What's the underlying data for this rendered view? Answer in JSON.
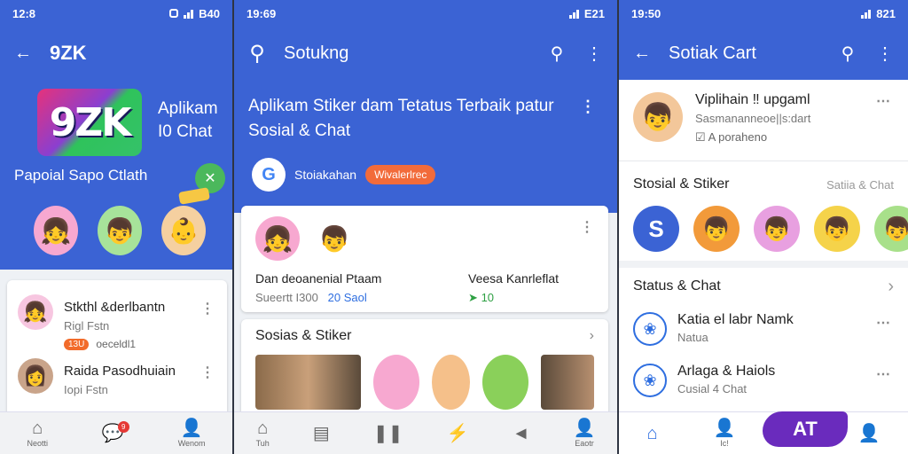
{
  "screen1": {
    "status_time": "12:8",
    "status_right": "B40",
    "title": "9ZK",
    "logo_text": "9ZK",
    "app_name_line1": "Aplikam",
    "app_name_line2": "I0 Chat",
    "tagline": "Papoial Sapo Ctlath",
    "chats": [
      {
        "name": "Stkthl &derlbantn",
        "sub": "Rigl Fstn",
        "meta": "oeceldl1",
        "pill": "13U"
      },
      {
        "name": "Raida Pasodhuiain",
        "sub": "Iopi Fstn"
      }
    ],
    "nav": [
      {
        "label": "Neotti",
        "icon": "home-icon"
      },
      {
        "label": "",
        "icon": "chat-icon",
        "badge": "9"
      },
      {
        "label": "Wenom",
        "icon": "profile-icon"
      }
    ]
  },
  "screen2": {
    "status_time": "19:69",
    "status_right": "E21",
    "search_title": "Sotukng",
    "headline": "Aplikam Stiker dam Tetatus Terbaik patur Sosial & Chat",
    "source": "Stoiakahan",
    "chip": "Wivalerlrec",
    "featured": {
      "col1_l1": "Dan deoanenial Ptaam",
      "col1_l2": "Sueertt I300",
      "col1_l2b": "20 Saol",
      "col2_l1": "Veesa Kanrleflat",
      "col2_l2": "10"
    },
    "section_title": "Sosias & Stiker",
    "nav": [
      {
        "label": "Tuh",
        "icon": "home-icon"
      },
      {
        "label": "",
        "icon": "document-icon"
      },
      {
        "label": "",
        "icon": "pause-icon"
      },
      {
        "label": "",
        "icon": "bolt-icon"
      },
      {
        "label": "",
        "icon": "megaphone-icon"
      },
      {
        "label": "Eaotr",
        "icon": "profile-icon"
      }
    ]
  },
  "screen3": {
    "status_time": "19:50",
    "status_right": "821",
    "title": "Sotiak Cart",
    "profile": {
      "name": "Viplihain ‼ upgaml",
      "sub": "Sasmananneoe||s:dart",
      "status": "A poraheno"
    },
    "section1_title": "Stosial & Stiker",
    "section1_right": "Satiia & Chat",
    "first_circle_letter": "S",
    "section2_title": "Status & Chat",
    "chats": [
      {
        "name": "Katia el labr Namk",
        "sub": "Natua"
      },
      {
        "name": "Arlaga & Haiols",
        "sub": "Cusial 4 Chat"
      }
    ],
    "blob_text": "AT",
    "nav": [
      {
        "label": "",
        "icon": "home-icon",
        "active": true
      },
      {
        "label": "Ic!",
        "icon": "profile-icon"
      },
      {
        "label": "",
        "icon": "profile-icon"
      }
    ]
  },
  "colors": {
    "primary_blue": "#3b63d4",
    "accent_blue": "#2e6ee0",
    "orange": "#f26b3a",
    "green": "#4bb85c",
    "purple": "#6a2bbd"
  }
}
